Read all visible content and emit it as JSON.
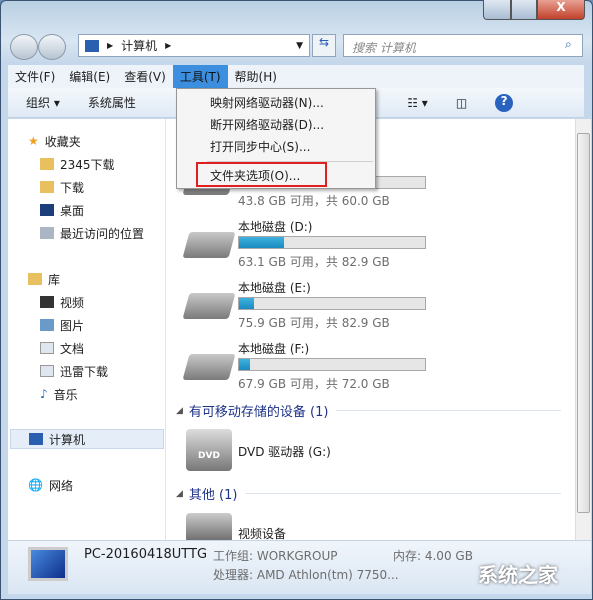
{
  "window": {
    "minimize": "—",
    "maximize": "□",
    "close": "X"
  },
  "address": {
    "path": "计算机",
    "search_placeholder": "搜索 计算机"
  },
  "menu": [
    "文件(F)",
    "编辑(E)",
    "查看(V)",
    "工具(T)",
    "帮助(H)"
  ],
  "toolbar": {
    "organize": "组织 ▾",
    "system_properties": "系统属性",
    "more": "»",
    "help": "?"
  },
  "tools_menu": [
    "映射网络驱动器(N)...",
    "断开网络驱动器(D)...",
    "打开同步中心(S)...",
    "文件夹选项(O)..."
  ],
  "nav": {
    "favorites": "收藏夹",
    "fav_items": [
      "2345下载",
      "下载",
      "桌面",
      "最近访问的位置"
    ],
    "libraries": "库",
    "lib_items": [
      "视频",
      "图片",
      "文档",
      "迅雷下载",
      "音乐"
    ],
    "computer": "计算机",
    "network": "网络"
  },
  "drives": [
    {
      "name": "",
      "free_text": "43.8 GB 可用，共 60.0 GB",
      "used_pct": 27
    },
    {
      "name": "本地磁盘 (D:)",
      "free_text": "63.1 GB 可用，共 82.9 GB",
      "used_pct": 24
    },
    {
      "name": "本地磁盘 (E:)",
      "free_text": "75.9 GB 可用，共 82.9 GB",
      "used_pct": 8
    },
    {
      "name": "本地磁盘 (F:)",
      "free_text": "67.9 GB 可用，共 72.0 GB",
      "used_pct": 6
    }
  ],
  "groups": {
    "removable": "有可移动存储的设备 (1)",
    "dvd": "DVD 驱动器 (G:)",
    "dvd_badge": "DVD",
    "other": "其他 (1)",
    "video": "视频设备"
  },
  "details": {
    "pc_name": "PC-20160418UTTG",
    "workgroup": "工作组: WORKGROUP",
    "memory": "内存: 4.00 GB",
    "cpu": "处理器: AMD Athlon(tm) 7750..."
  },
  "watermark": "系统之家"
}
